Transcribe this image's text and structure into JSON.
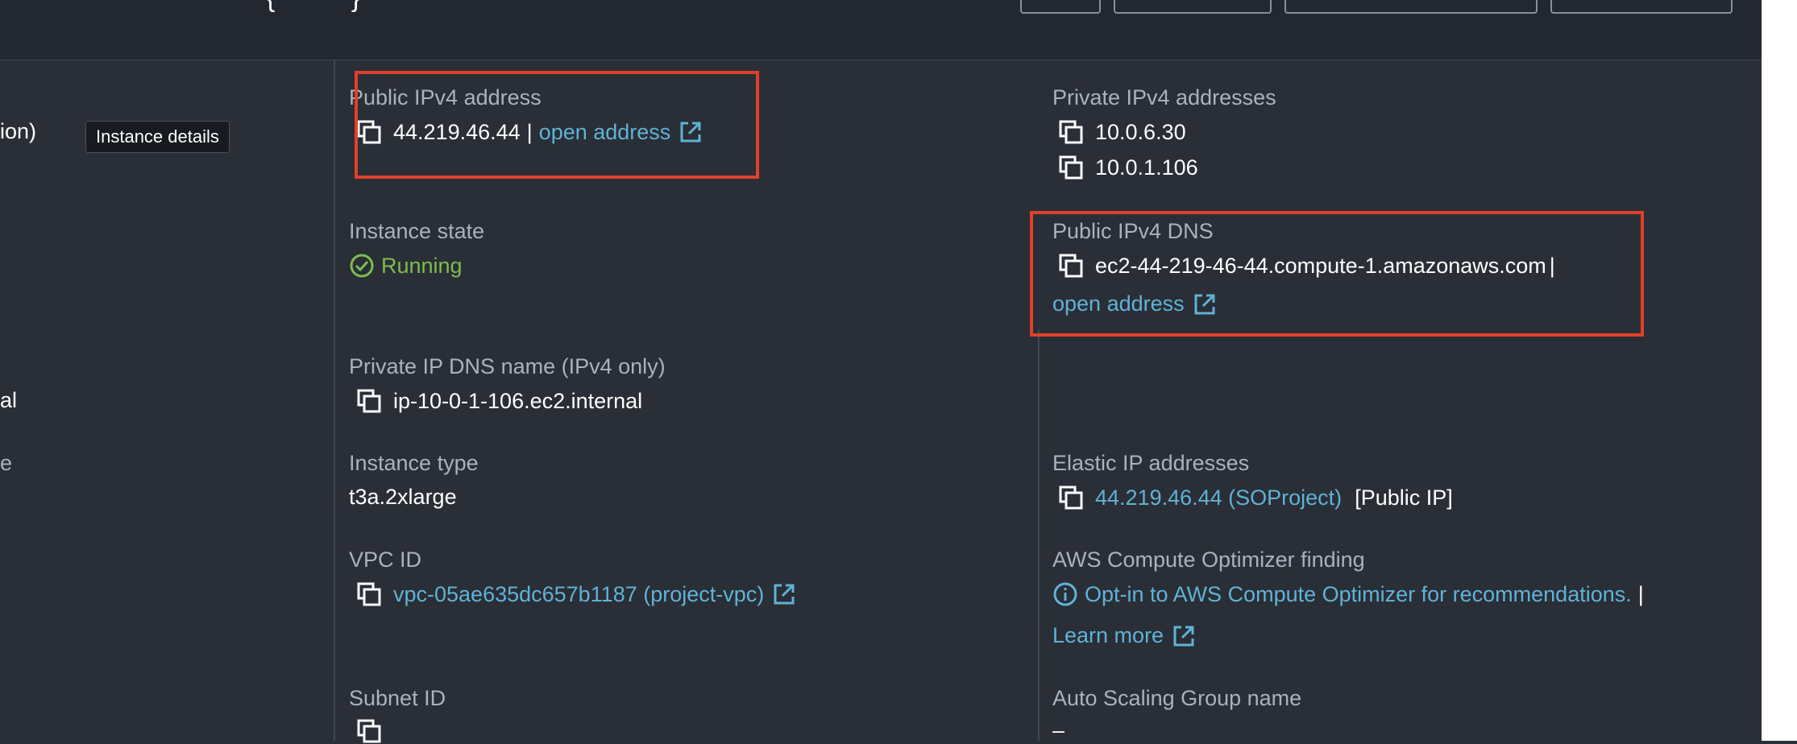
{
  "left_col": {
    "partial_1": "ion)",
    "partial_2": "al",
    "partial_3": "e"
  },
  "tooltip": {
    "text": "Instance details"
  },
  "fields": {
    "public_ipv4": {
      "label": "Public IPv4 address",
      "value": "44.219.46.44",
      "separator": "|",
      "link": "open address"
    },
    "private_ipv4": {
      "label": "Private IPv4 addresses",
      "values": [
        "10.0.6.30",
        "10.0.1.106"
      ]
    },
    "instance_state": {
      "label": "Instance state",
      "value": "Running",
      "status_color": "#7cbd4f"
    },
    "public_dns": {
      "label": "Public IPv4 DNS",
      "value": "ec2-44-219-46-44.compute-1.amazonaws.com",
      "separator": "|",
      "link": "open address"
    },
    "private_dns": {
      "label": "Private IP DNS name (IPv4 only)",
      "value": "ip-10-0-1-106.ec2.internal"
    },
    "instance_type": {
      "label": "Instance type",
      "value": "t3a.2xlarge"
    },
    "elastic_ip": {
      "label": "Elastic IP addresses",
      "link": "44.219.46.44 (SOProject)",
      "suffix": "[Public IP]"
    },
    "vpc": {
      "label": "VPC ID",
      "link": "vpc-05ae635dc657b1187 (project-vpc)"
    },
    "optimizer": {
      "label": "AWS Compute Optimizer finding",
      "link": "Opt-in to AWS Compute Optimizer for recommendations.",
      "separator": "|",
      "learn_more": "Learn more"
    },
    "subnet": {
      "label": "Subnet ID"
    },
    "asg": {
      "label": "Auto Scaling Group name",
      "value": "–"
    }
  },
  "colors": {
    "background": "#2a2e36",
    "link": "#5fb3d6",
    "label": "#aab2bd",
    "highlight": "#e0412a"
  },
  "icons": [
    "copy-icon",
    "external-link-icon",
    "check-circle-icon",
    "info-icon"
  ]
}
